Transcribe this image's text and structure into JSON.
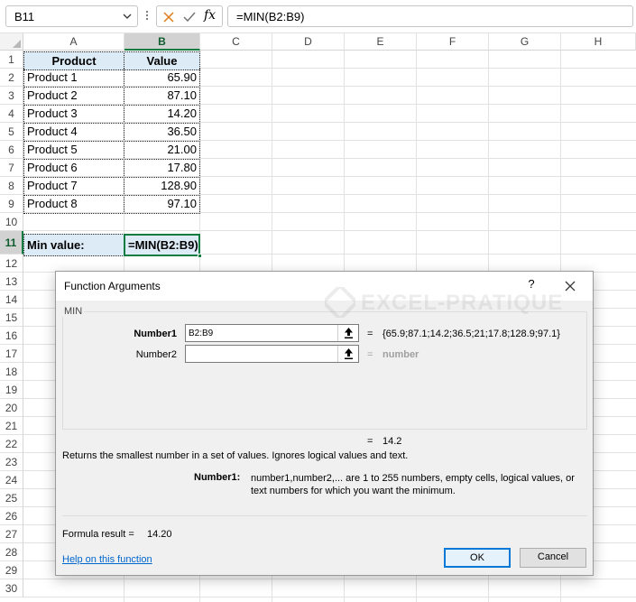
{
  "formula_bar": {
    "name_box": "B11",
    "formula": "=MIN(B2:B9)",
    "fx_label": "fx"
  },
  "columns": [
    "A",
    "B",
    "C",
    "D",
    "E",
    "F",
    "G",
    "H"
  ],
  "selected_column": "B",
  "rows": [
    "1",
    "2",
    "3",
    "4",
    "5",
    "6",
    "7",
    "8",
    "9",
    "10",
    "11",
    "12",
    "13",
    "14",
    "15",
    "16",
    "17",
    "18",
    "19",
    "20",
    "21",
    "22",
    "23",
    "24",
    "25",
    "26",
    "27",
    "28",
    "29",
    "30"
  ],
  "selected_row": "11",
  "table": {
    "header_product": "Product",
    "header_value": "Value",
    "items": [
      {
        "product": "Product 1",
        "value": "65.90"
      },
      {
        "product": "Product 2",
        "value": "87.10"
      },
      {
        "product": "Product 3",
        "value": "14.20"
      },
      {
        "product": "Product 4",
        "value": "36.50"
      },
      {
        "product": "Product 5",
        "value": "21.00"
      },
      {
        "product": "Product 6",
        "value": "17.80"
      },
      {
        "product": "Product 7",
        "value": "128.90"
      },
      {
        "product": "Product 8",
        "value": "97.10"
      }
    ],
    "min_label": "Min value:",
    "min_formula": "=MIN(B2:B9)"
  },
  "dialog": {
    "title": "Function Arguments",
    "help_symbol": "?",
    "function_name": "MIN",
    "arg1_label": "Number1",
    "arg1_value": "B2:B9",
    "arg1_result": "{65.9;87.1;14.2;36.5;21;17.8;128.9;97.1}",
    "arg2_label": "Number2",
    "arg2_value": "",
    "arg2_result": "number",
    "equals": "=",
    "result": "14.2",
    "description": "Returns the smallest number in a set of values. Ignores logical values and text.",
    "arg_help_label": "Number1:",
    "arg_help_text": "number1,number2,... are 1 to 255 numbers, empty cells, logical values, or text numbers for which you want the minimum.",
    "formula_result_label": "Formula result =",
    "formula_result_value": "14.20",
    "help_link": "Help on this function",
    "ok_label": "OK",
    "cancel_label": "Cancel"
  },
  "watermark": "EXCEL-PRATIQUE",
  "colors": {
    "accent_green": "#107c41",
    "header_fill": "#ddebf7",
    "link_blue": "#0066cc",
    "ok_border": "#0078d7"
  }
}
